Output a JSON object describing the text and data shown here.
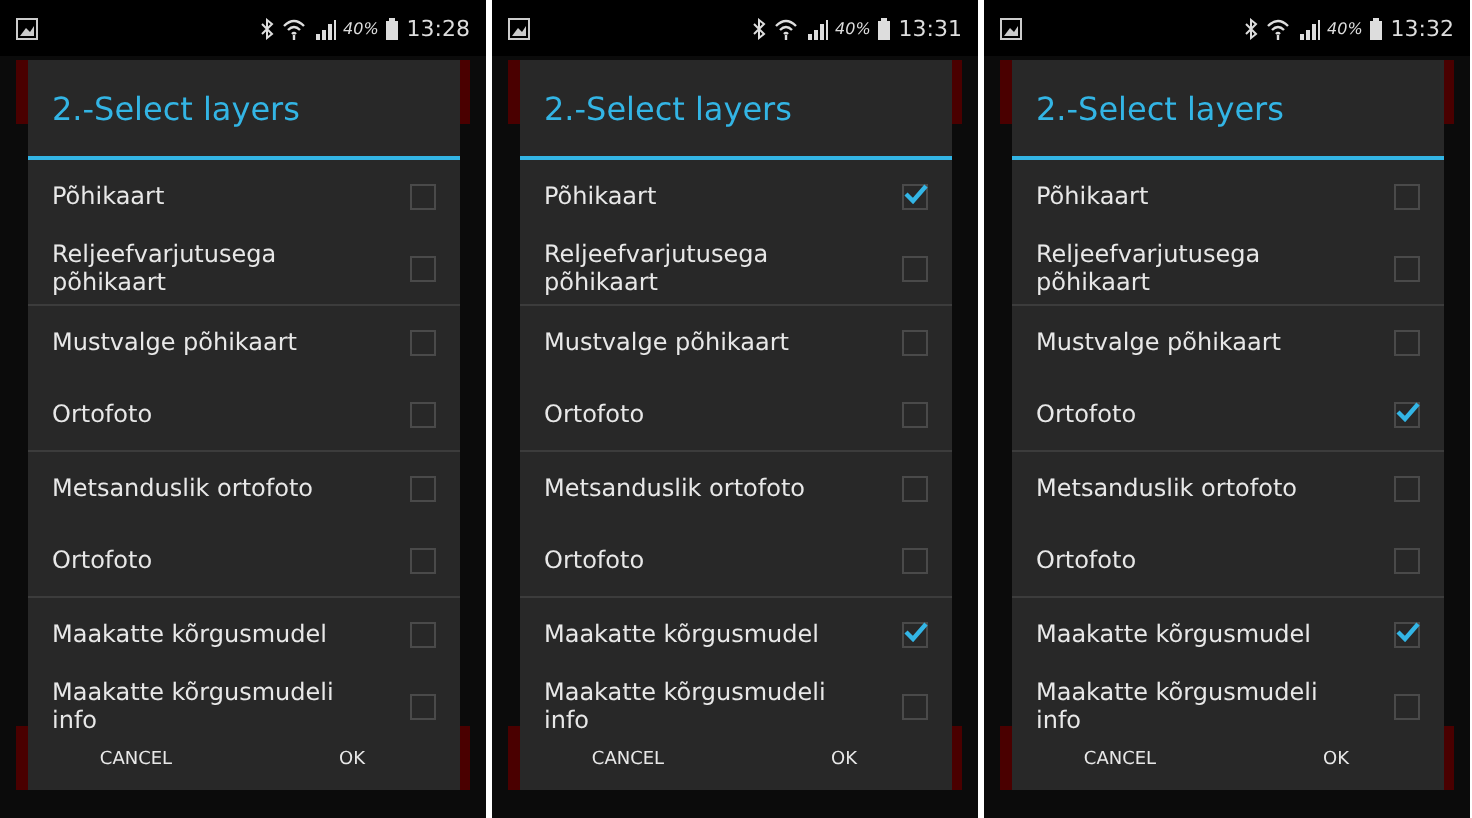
{
  "screens": [
    {
      "status_bar": {
        "battery_text": "40%",
        "time": "13:28"
      },
      "dialog": {
        "title": "2.-Select layers",
        "groups": [
          [
            {
              "label": "Põhikaart",
              "checked": false
            },
            {
              "label": "Reljeefvarjutusega põhikaart",
              "checked": false
            }
          ],
          [
            {
              "label": "Mustvalge põhikaart",
              "checked": false
            },
            {
              "label": "Ortofoto",
              "checked": false
            }
          ],
          [
            {
              "label": "Metsanduslik ortofoto",
              "checked": false
            },
            {
              "label": "Ortofoto",
              "checked": false
            }
          ],
          [
            {
              "label": "Maakatte kõrgusmudel",
              "checked": false
            },
            {
              "label": "Maakatte kõrgusmudeli info",
              "checked": false
            }
          ]
        ],
        "buttons": [
          "CANCEL",
          "OK"
        ]
      }
    },
    {
      "status_bar": {
        "battery_text": "40%",
        "time": "13:31"
      },
      "dialog": {
        "title": "2.-Select layers",
        "groups": [
          [
            {
              "label": "Põhikaart",
              "checked": true
            },
            {
              "label": "Reljeefvarjutusega põhikaart",
              "checked": false
            }
          ],
          [
            {
              "label": "Mustvalge põhikaart",
              "checked": false
            },
            {
              "label": "Ortofoto",
              "checked": false
            }
          ],
          [
            {
              "label": "Metsanduslik ortofoto",
              "checked": false
            },
            {
              "label": "Ortofoto",
              "checked": false
            }
          ],
          [
            {
              "label": "Maakatte kõrgusmudel",
              "checked": true
            },
            {
              "label": "Maakatte kõrgusmudeli info",
              "checked": false
            }
          ]
        ],
        "buttons": [
          "CANCEL",
          "OK"
        ]
      }
    },
    {
      "status_bar": {
        "battery_text": "40%",
        "time": "13:32"
      },
      "dialog": {
        "title": "2.-Select layers",
        "groups": [
          [
            {
              "label": "Põhikaart",
              "checked": false
            },
            {
              "label": "Reljeefvarjutusega põhikaart",
              "checked": false
            }
          ],
          [
            {
              "label": "Mustvalge põhikaart",
              "checked": false
            },
            {
              "label": "Ortofoto",
              "checked": true
            }
          ],
          [
            {
              "label": "Metsanduslik ortofoto",
              "checked": false
            },
            {
              "label": "Ortofoto",
              "checked": false
            }
          ],
          [
            {
              "label": "Maakatte kõrgusmudel",
              "checked": true
            },
            {
              "label": "Maakatte kõrgusmudeli info",
              "checked": false
            }
          ]
        ],
        "buttons": [
          "CANCEL",
          "OK"
        ]
      }
    }
  ]
}
